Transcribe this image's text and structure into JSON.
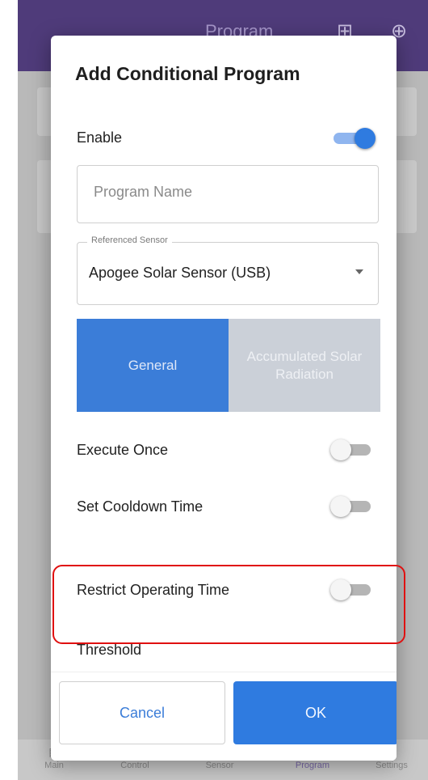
{
  "app_bar": {
    "title": "Program",
    "icons": [
      "add-chart-icon",
      "globe-icon"
    ],
    "add_icon_glyph": "⊞",
    "globe_icon_glyph": "⊕"
  },
  "bottom_nav": {
    "items": [
      {
        "label": "Main",
        "icon": "home-icon",
        "glyph": "▦"
      },
      {
        "label": "Control",
        "icon": "control-icon",
        "glyph": "≡"
      },
      {
        "label": "Sensor",
        "icon": "sensor-icon",
        "glyph": "●"
      },
      {
        "label": "Program",
        "icon": "program-icon",
        "glyph": "▭",
        "active": true
      },
      {
        "label": "Settings",
        "icon": "settings-icon",
        "glyph": "↗"
      }
    ]
  },
  "dialog": {
    "title": "Add Conditional Program",
    "enable": {
      "label": "Enable",
      "value": true
    },
    "program_name": {
      "placeholder": "Program Name",
      "value": ""
    },
    "referenced_sensor": {
      "label": "Referenced Sensor",
      "value": "Apogee Solar Sensor (USB)"
    },
    "tabs": [
      {
        "label": "General",
        "selected": true
      },
      {
        "label": "Accumulated Solar Radiation",
        "selected": false
      }
    ],
    "options": [
      {
        "label": "Execute Once",
        "value": false
      },
      {
        "label": "Set Cooldown Time",
        "value": false
      },
      {
        "label": "Restrict Operating Time",
        "value": false,
        "highlighted": true
      }
    ],
    "threshold_label": "Threshold",
    "buttons": {
      "cancel": "Cancel",
      "ok": "OK"
    }
  },
  "colors": {
    "app_bar": "#4f3b7a",
    "primary": "#2f7be0",
    "tab_selected": "#3b7dd8",
    "tab_unselected": "#cbd0d8",
    "highlight": "#e01010"
  }
}
